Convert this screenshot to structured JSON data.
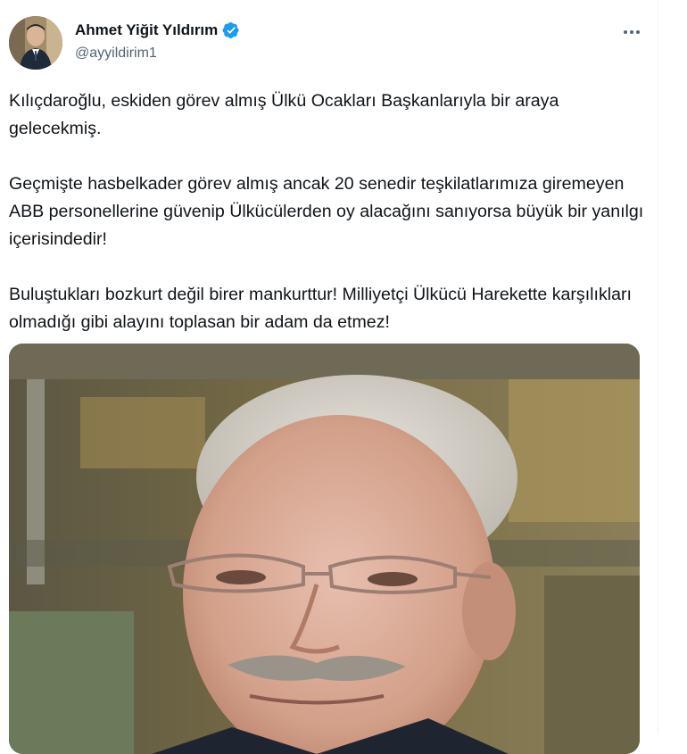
{
  "author": {
    "display_name": "Ahmet Yiğit Yıldırım",
    "handle": "@ayyildirim1",
    "verified": true
  },
  "icons": {
    "verified": "verified-badge-icon",
    "more": "more-options-icon"
  },
  "colors": {
    "verified_blue": "#1d9bf0",
    "text": "#0f1419",
    "secondary_text": "#536471"
  },
  "tweet": {
    "paragraphs": [
      "Kılıçdaroğlu, eskiden görev almış Ülkü Ocakları Başkanlarıyla bir araya gelecekmiş.",
      "Geçmişte hasbelkader görev almış ancak 20 senedir teşkilatlarımıza giremeyen ABB personellerine güvenip Ülkücülerden oy alacağını sanıyorsa büyük bir yanılgı içerisindedir!",
      "Buluştukları bozkurt değil birer mankurttur! Milliyetçi Ülkücü Harekette karşılıkları olmadığı gibi alayını toplasan bir adam da etmez!"
    ]
  }
}
